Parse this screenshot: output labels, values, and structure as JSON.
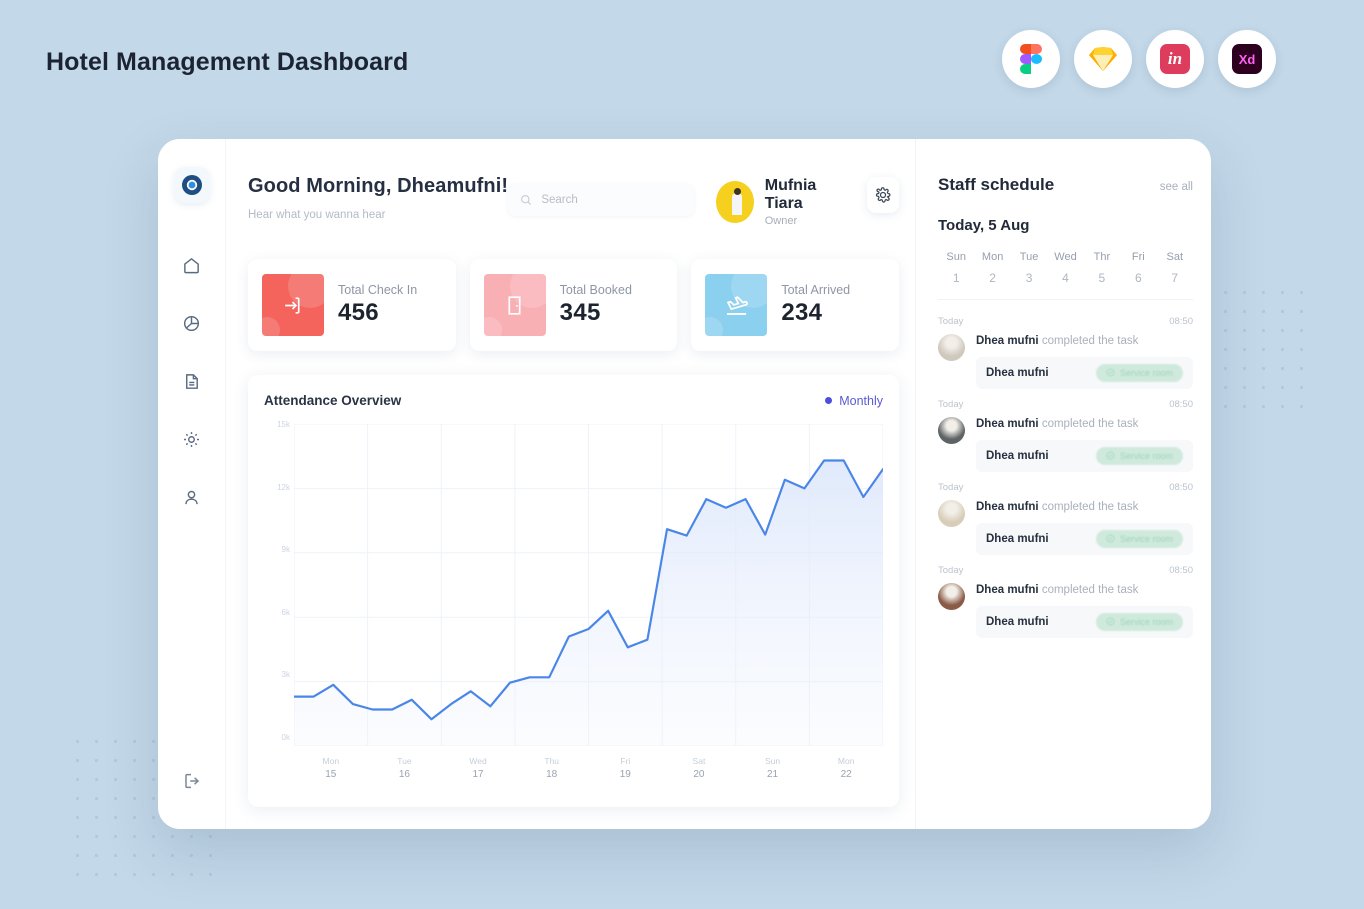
{
  "page": {
    "title": "Hotel Management Dashboard",
    "tools": [
      {
        "name": "figma",
        "label": "Figma"
      },
      {
        "name": "sketch",
        "label": "Sketch"
      },
      {
        "name": "invision",
        "label": "in"
      },
      {
        "name": "adobe-xd",
        "label": "Xd"
      }
    ]
  },
  "sidebar": {
    "items": [
      {
        "name": "home",
        "label": "Home"
      },
      {
        "name": "analytics",
        "label": "Analytics"
      },
      {
        "name": "documents",
        "label": "Documents"
      },
      {
        "name": "settings",
        "label": "Settings"
      },
      {
        "name": "profile",
        "label": "Profile"
      }
    ],
    "logout_label": "Logout"
  },
  "header": {
    "greeting": "Good Morning, Dheamufni!",
    "subtitle": "Hear what you  wanna hear",
    "search_placeholder": "Search",
    "search_value": "",
    "profile_name": "Mufnia Tiara",
    "profile_role": "Owner"
  },
  "stats": [
    {
      "label": "Total Check In",
      "value": "456",
      "color": "#f4635c",
      "icon": "check-in-icon"
    },
    {
      "label": "Total Booked",
      "value": "345",
      "color": "#f9b0b5",
      "icon": "door-icon"
    },
    {
      "label": "Total Arrived",
      "value": "234",
      "color": "#8bd0ef",
      "icon": "plane-landing-icon"
    }
  ],
  "chart_panel": {
    "title": "Attendance Overview",
    "legend_label": "Monthly",
    "legend_color": "#5b5bd6"
  },
  "chart_data": {
    "type": "area",
    "title": "Attendance Overview",
    "xlabel": "",
    "ylabel": "",
    "ylim": [
      0,
      15000
    ],
    "ytick_labels": [
      "15k",
      "12k",
      "9k",
      "6k",
      "3k",
      "0k"
    ],
    "ytick_values": [
      15000,
      12000,
      9000,
      6000,
      3000,
      0
    ],
    "grid": true,
    "legend_position": "top-right",
    "x_axis": [
      {
        "day": "Mon",
        "date": "15"
      },
      {
        "day": "Tue",
        "date": "16"
      },
      {
        "day": "Wed",
        "date": "17"
      },
      {
        "day": "Thu",
        "date": "18"
      },
      {
        "day": "Fri",
        "date": "19"
      },
      {
        "day": "Sat",
        "date": "20"
      },
      {
        "day": "Sun",
        "date": "21"
      },
      {
        "day": "Mon",
        "date": "22"
      }
    ],
    "series": [
      {
        "name": "Monthly",
        "color": "#4a86e8",
        "values": [
          2300,
          2300,
          2850,
          1950,
          1700,
          1700,
          2150,
          1250,
          1950,
          2550,
          1850,
          2950,
          3200,
          3200,
          5100,
          5450,
          6300,
          4600,
          4950,
          10100,
          9800,
          11500,
          11100,
          11500,
          9850,
          12400,
          12000,
          13300,
          13300,
          11600,
          12900
        ]
      }
    ]
  },
  "schedule": {
    "title": "Staff schedule",
    "see_all": "see all",
    "today_label": "Today, 5 Aug",
    "week_days": [
      "Sun",
      "Mon",
      "Tue",
      "Wed",
      "Thr",
      "Fri",
      "Sat"
    ],
    "week_dates": [
      "1",
      "2",
      "3",
      "4",
      "5",
      "6",
      "7"
    ],
    "feed": [
      {
        "when": "Today",
        "time": "08:50",
        "actor": "Dhea mufni",
        "action": " completed the task",
        "task_name": "Dhea mufni",
        "badge": "Service room",
        "avatar_color": "#cfc9bd"
      },
      {
        "when": "Today",
        "time": "08:50",
        "actor": "Dhea mufni",
        "action": " completed the task",
        "task_name": "Dhea mufni",
        "badge": "Service room",
        "avatar_color": "#5e6366"
      },
      {
        "when": "Today",
        "time": "08:50",
        "actor": "Dhea mufni",
        "action": " completed the task",
        "task_name": "Dhea mufni",
        "badge": "Service room",
        "avatar_color": "#d8cdb8"
      },
      {
        "when": "Today",
        "time": "08:50",
        "actor": "Dhea mufni",
        "action": " completed the task",
        "task_name": "Dhea mufni",
        "badge": "Service room",
        "avatar_color": "#8a5a46"
      }
    ]
  }
}
